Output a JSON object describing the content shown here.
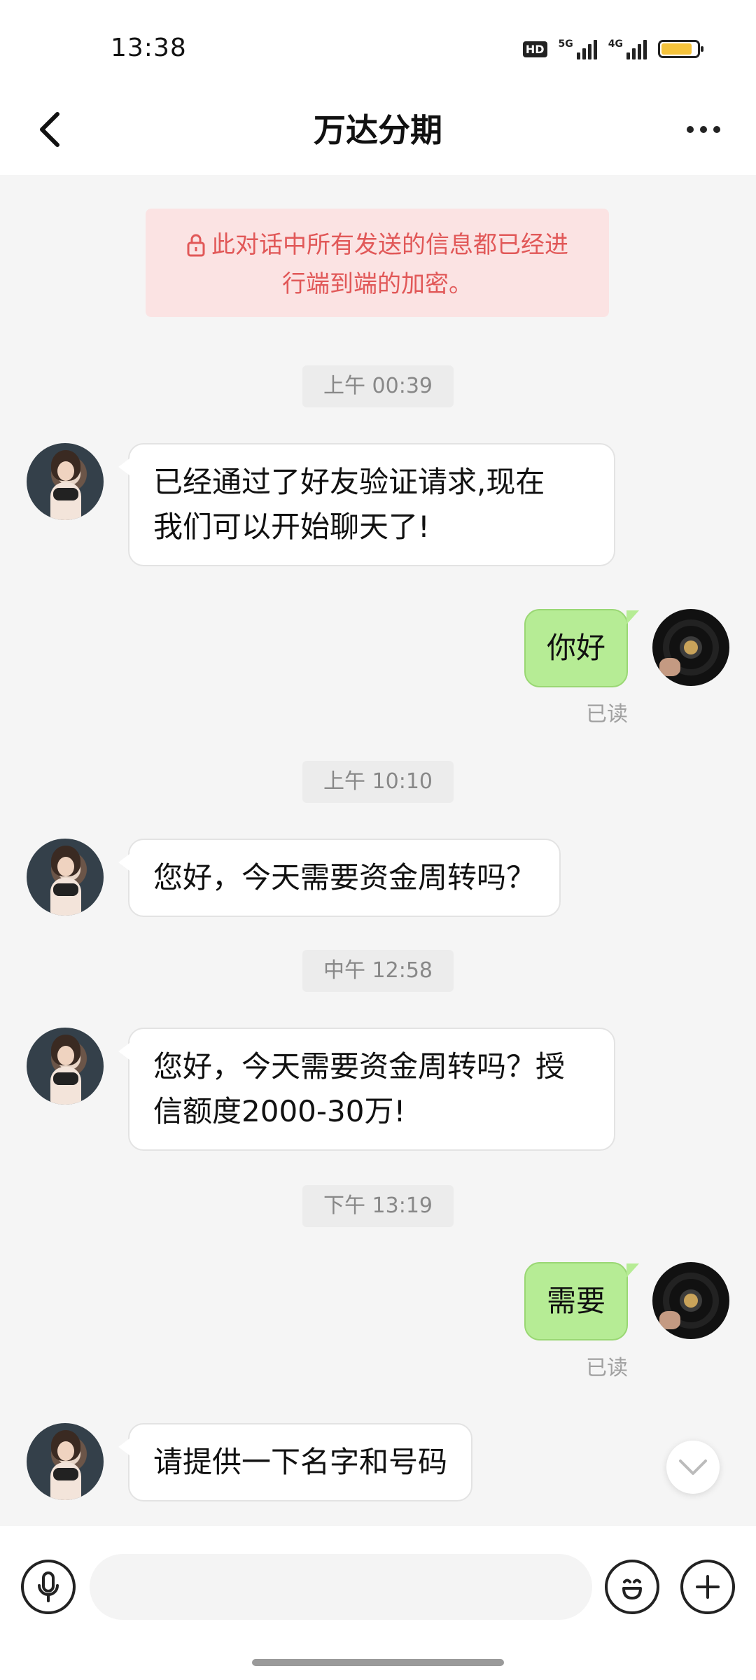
{
  "status_bar": {
    "time": "13:38",
    "hd_label": "HD",
    "net1": "5G",
    "net2": "4G",
    "battery_level": 0.85
  },
  "header": {
    "title": "万达分期",
    "back_icon": "chevron-left-icon",
    "more_icon": "more-dots-icon"
  },
  "notice": {
    "icon": "lock-icon",
    "line1": "此对话中所有发送的信息都已经进",
    "line2": "行端到端的加密。"
  },
  "messages": [
    {
      "type": "time",
      "text": "上午 00:39"
    },
    {
      "type": "received",
      "line1": "已经通过了好友验证请求,现在",
      "line2": "我们可以开始聊天了!"
    },
    {
      "type": "sent",
      "text": "你好",
      "status": "已读"
    },
    {
      "type": "time",
      "text": "上午 10:10"
    },
    {
      "type": "received",
      "text": "您好，今天需要资金周转吗？"
    },
    {
      "type": "time",
      "text": "中午 12:58"
    },
    {
      "type": "received",
      "line1": "您好，今天需要资金周转吗？授",
      "line2": "信额度2000-30万!"
    },
    {
      "type": "time",
      "text": "下午 13:19"
    },
    {
      "type": "sent",
      "text": "需要",
      "status": "已读"
    },
    {
      "type": "received",
      "text": "请提供一下名字和号码"
    }
  ],
  "input": {
    "placeholder": "",
    "voice_icon": "microphone-icon",
    "emoji_icon": "emoji-icon",
    "plus_icon": "plus-icon"
  },
  "colors": {
    "sent_bubble": "#b6ec95",
    "notice_bg": "#fbe3e3",
    "notice_text": "#e15858"
  }
}
